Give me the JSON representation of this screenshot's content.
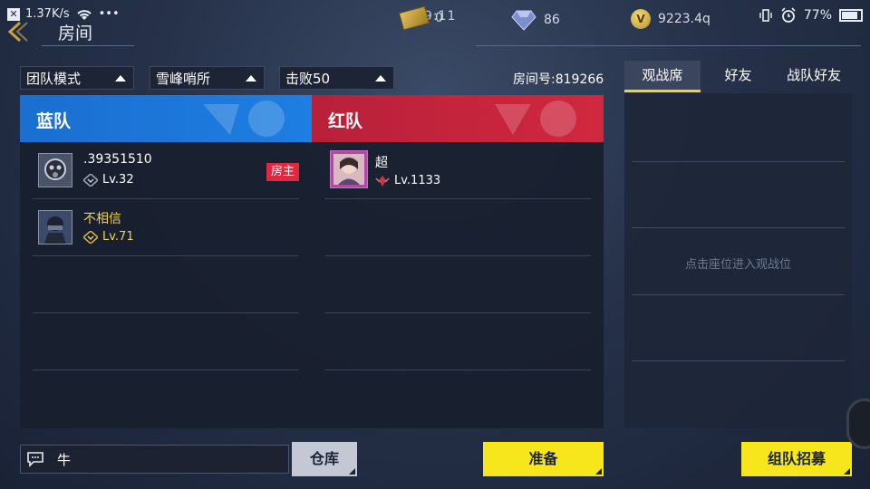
{
  "statusbar": {
    "speed": "1.37K/s",
    "dots": "•••",
    "clock": "09:11",
    "battery_pct": "77%"
  },
  "header": {
    "title": "房间"
  },
  "currency": {
    "tickets": "0",
    "diamonds": "86",
    "gold": "9223.4q",
    "gold_symbol": "V"
  },
  "filters": {
    "mode": "团队模式",
    "map": "雪峰哨所",
    "goal": "击败50"
  },
  "room": {
    "label": "房间号:819266"
  },
  "teams": {
    "blue": {
      "name": "蓝队",
      "players": [
        {
          "name": ".39351510",
          "level": "Lv.32",
          "vip": false,
          "host": true
        },
        {
          "name": "不相信",
          "level": "Lv.71",
          "vip": true,
          "host": false
        }
      ]
    },
    "red": {
      "name": "红队",
      "players": [
        {
          "name": "超",
          "level": "Lv.1133",
          "vip": false,
          "host": false
        }
      ]
    },
    "host_label": "房主"
  },
  "side": {
    "tabs": [
      "观战席",
      "好友",
      "战队好友"
    ],
    "active_tab": 0,
    "hint": "点击座位进入观战位"
  },
  "bottom": {
    "chat_text": "牛",
    "warehouse": "仓库",
    "ready": "准备",
    "recruit": "组队招募"
  },
  "colors": {
    "blue_team": "#1e7ee2",
    "red_team": "#d0283f",
    "accent_yellow": "#f8e61c",
    "tab_underline": "#f2d230",
    "vip_gold": "#f2d24a"
  }
}
